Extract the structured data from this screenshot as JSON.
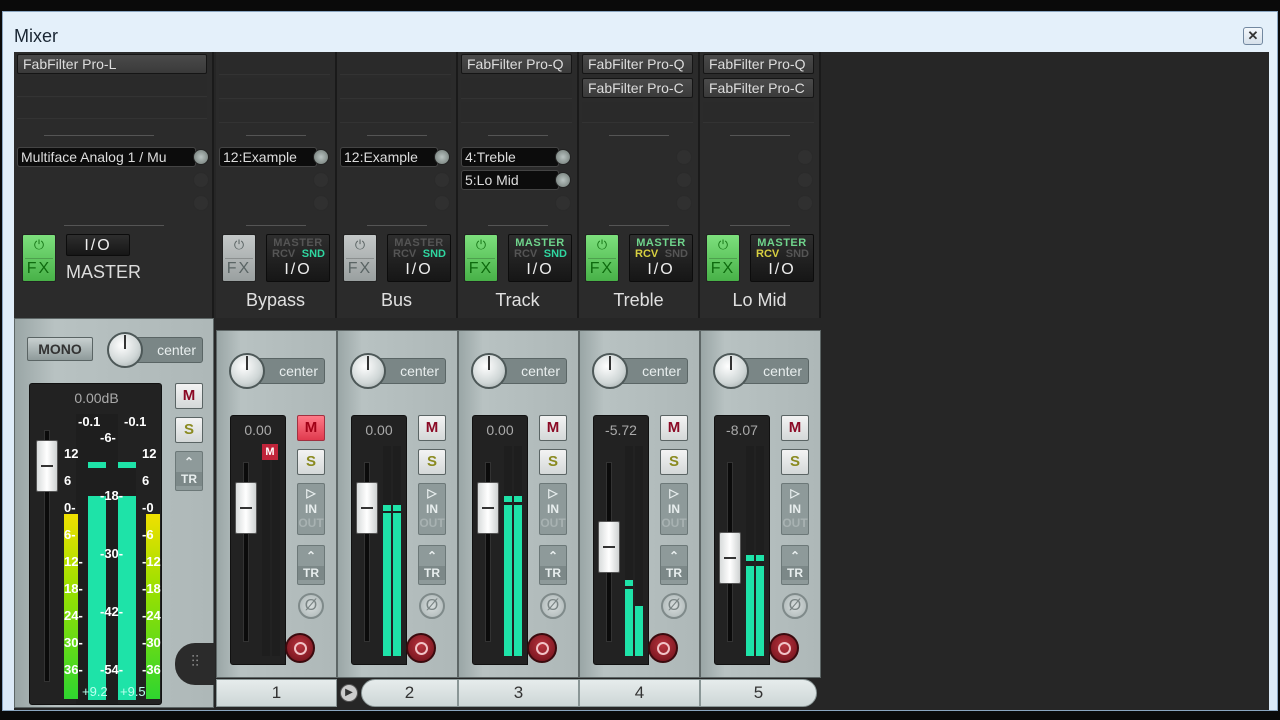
{
  "window": {
    "title": "Mixer",
    "close_icon": "close-icon"
  },
  "master": {
    "fx": [
      "FabFilter Pro-L"
    ],
    "sends": [
      "Multiface Analog 1 / Mu"
    ],
    "fx_button": {
      "power": "⏻",
      "label": "FX",
      "state": "on"
    },
    "io_label": "I/O",
    "name": "MASTER",
    "mono_label": "MONO",
    "pan_label": "center",
    "volume_db": "0.00dB",
    "peak_left": "-0.1",
    "peak_right": "-0.1",
    "rms_left": "+9.2",
    "rms_right": "+9.5",
    "scale_left": [
      "12",
      "6",
      "0-",
      "6-",
      "12-",
      "18-",
      "24-",
      "30-",
      "36-"
    ],
    "scale_center": [
      "-6-",
      "-18-",
      "-30-",
      "-42-",
      "-54-"
    ],
    "scale_right": [
      "12",
      "6",
      "-0",
      "-6",
      "-12",
      "-18",
      "-24",
      "-30",
      "-36"
    ],
    "mute_label": "M",
    "solo_label": "S",
    "tr_label": "TR",
    "meter_level_left": 0.88,
    "meter_level_right": 0.88
  },
  "tracks": [
    {
      "number": "1",
      "name": "Bypass",
      "fx": [],
      "sends": [
        "12:Example"
      ],
      "fx_state": "off",
      "master_color": "#555",
      "rcv_color": "#555",
      "snd_color": "#2fd6a0",
      "volume": "0.00",
      "pan": "center",
      "mute_on": true,
      "fader_pos": 0.78,
      "meter_l": 0.0,
      "meter_r": 0.0,
      "peak_l": null,
      "peak_r": null
    },
    {
      "number": "2",
      "name": "Bus",
      "fx": [],
      "sends": [
        "12:Example"
      ],
      "fx_state": "off",
      "master_color": "#555",
      "rcv_color": "#555",
      "snd_color": "#2fd6a0",
      "volume": "0.00",
      "pan": "center",
      "mute_on": false,
      "fader_pos": 0.78,
      "meter_l": 0.68,
      "meter_r": 0.68,
      "peak_l": 0.72,
      "peak_r": 0.72
    },
    {
      "number": "3",
      "name": "Track",
      "fx": [
        "FabFilter Pro-Q"
      ],
      "sends": [
        "4:Treble",
        "5:Lo Mid"
      ],
      "fx_state": "on",
      "master_color": "#6fd48c",
      "rcv_color": "#555",
      "snd_color": "#2fd6a0",
      "volume": "0.00",
      "pan": "center",
      "mute_on": false,
      "fader_pos": 0.78,
      "meter_l": 0.72,
      "meter_r": 0.72,
      "peak_l": 0.76,
      "peak_r": 0.76
    },
    {
      "number": "4",
      "name": "Treble",
      "fx": [
        "FabFilter Pro-Q",
        "FabFilter Pro-C"
      ],
      "sends": [],
      "fx_state": "on",
      "master_color": "#6fd48c",
      "rcv_color": "#d8d040",
      "snd_color": "#555",
      "volume": "-5.72",
      "pan": "center",
      "mute_on": false,
      "fader_pos": 0.56,
      "meter_l": 0.32,
      "meter_r": 0.24,
      "peak_l": 0.36,
      "peak_r": null
    },
    {
      "number": "5",
      "name": "Lo Mid",
      "fx": [
        "FabFilter Pro-Q",
        "FabFilter Pro-C"
      ],
      "sends": [],
      "fx_state": "on",
      "master_color": "#6fd48c",
      "rcv_color": "#d8d040",
      "snd_color": "#555",
      "volume": "-8.07",
      "pan": "center",
      "mute_on": false,
      "fader_pos": 0.5,
      "meter_l": 0.43,
      "meter_r": 0.43,
      "peak_l": 0.48,
      "peak_r": 0.48
    }
  ],
  "labels": {
    "master": "MASTER",
    "rcv": "RCV",
    "snd": "SND",
    "io": "I/O",
    "fx": "FX",
    "mute": "M",
    "solo": "S",
    "in": "IN",
    "out": "OUT",
    "tr": "TR",
    "phase": "Ø",
    "play": "▶"
  }
}
